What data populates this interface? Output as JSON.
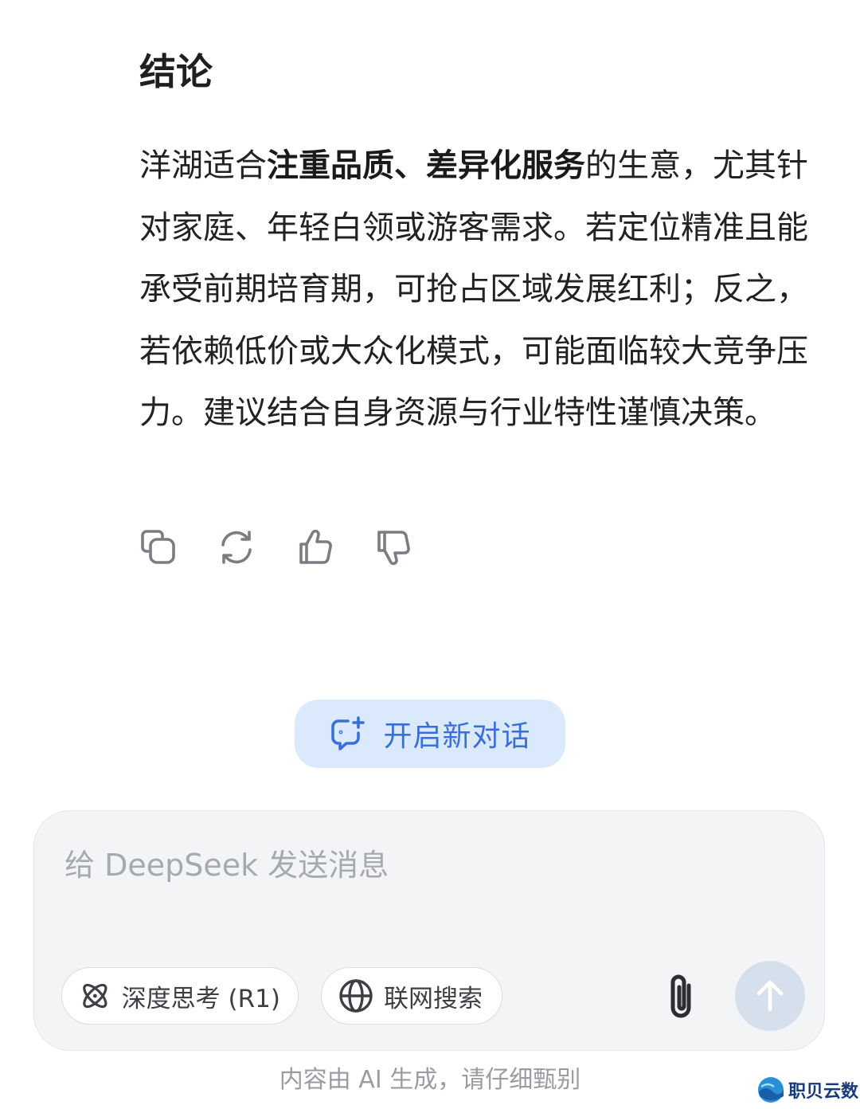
{
  "message": {
    "heading": "结论",
    "paragraph": {
      "part1": "洋湖适合",
      "bold": "注重品质、差异化服务",
      "part2": "的生意，尤其针对家庭、年轻白领或游客需求。若定位精准且能承受前期培育期，可抢占区域发展红利；反之，若依赖低价或大众化模式，可能面临较大竞争压力。建议结合自身资源与行业特性谨慎决策。"
    },
    "actions": [
      {
        "icon": "copy-icon"
      },
      {
        "icon": "regenerate-icon"
      },
      {
        "icon": "thumbs-up-icon"
      },
      {
        "icon": "thumbs-down-icon"
      }
    ]
  },
  "new_chat": {
    "label": "开启新对话",
    "icon": "new-chat-icon"
  },
  "composer": {
    "placeholder": "给 DeepSeek 发送消息",
    "deep_think_label": "深度思考 (R1)",
    "web_search_label": "联网搜索",
    "attach_icon": "paperclip-icon",
    "send_icon": "arrow-up-icon"
  },
  "footer": {
    "disclaimer": "内容由 AI 生成，请仔细甄别"
  },
  "watermark": {
    "text": "职贝云数"
  },
  "colors": {
    "accent": "#3b6fd8",
    "new_chat_bg": "#dbe9fc",
    "composer_bg": "#f3f4f6",
    "send_disabled_bg": "#d6e0ec"
  }
}
